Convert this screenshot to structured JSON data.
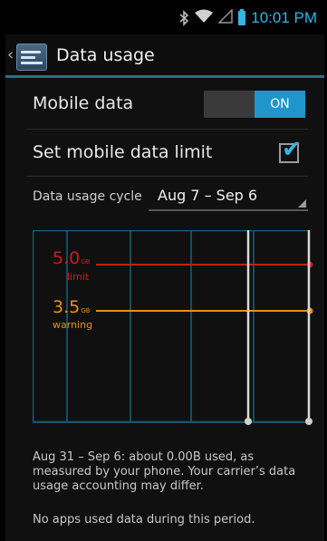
{
  "status_bar": {
    "time": "10:01 PM"
  },
  "action_bar": {
    "title": "Data usage"
  },
  "mobile_data": {
    "label": "Mobile data",
    "toggle_state": "ON"
  },
  "data_limit": {
    "label": "Set mobile data limit",
    "checked": true
  },
  "usage_cycle": {
    "label": "Data usage cycle",
    "value": "Aug 7 – Sep 6"
  },
  "chart": {
    "limit": {
      "value": "5.0",
      "unit": "GB",
      "label": "limit",
      "color": "#cc1b1b"
    },
    "warning": {
      "value": "3.5",
      "unit": "GB",
      "label": "warning",
      "color": "#e8920c"
    }
  },
  "info": {
    "usage_text": "Aug 31 – Sep 6: about 0.00B used, as measured by your phone. Your carrier’s data usage accounting may differ.",
    "apps_text": "No apps used data during this period."
  },
  "colors": {
    "accent": "#33b5e5",
    "grid": "#1b5f7a",
    "marker_line": "#d9d9d9"
  }
}
